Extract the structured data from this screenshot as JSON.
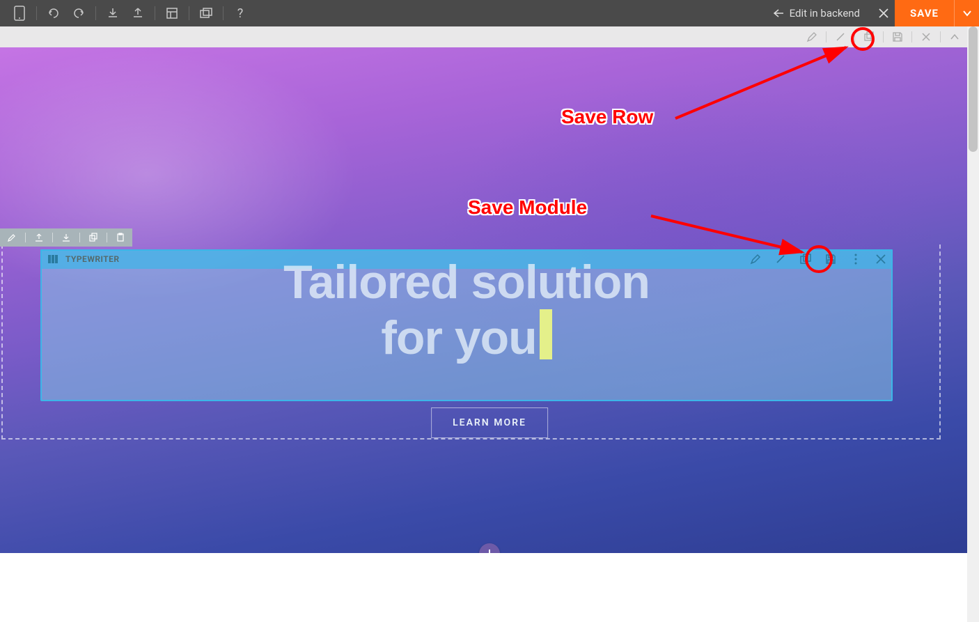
{
  "toolbar": {
    "edit_backend": "Edit in backend",
    "save_label": "SAVE"
  },
  "module": {
    "name": "TYPEWRITER",
    "heading_line1": "Tailored solution",
    "heading_line2": "for you"
  },
  "cta": {
    "learn_more": "LEARN MORE"
  },
  "annotations": {
    "save_row": "Save Row",
    "save_module": "Save Module"
  },
  "icons": {
    "mobile": "mobile",
    "undo": "undo",
    "redo": "redo",
    "download": "download",
    "upload": "upload",
    "layout": "layout",
    "layers": "layers",
    "help": "?"
  }
}
